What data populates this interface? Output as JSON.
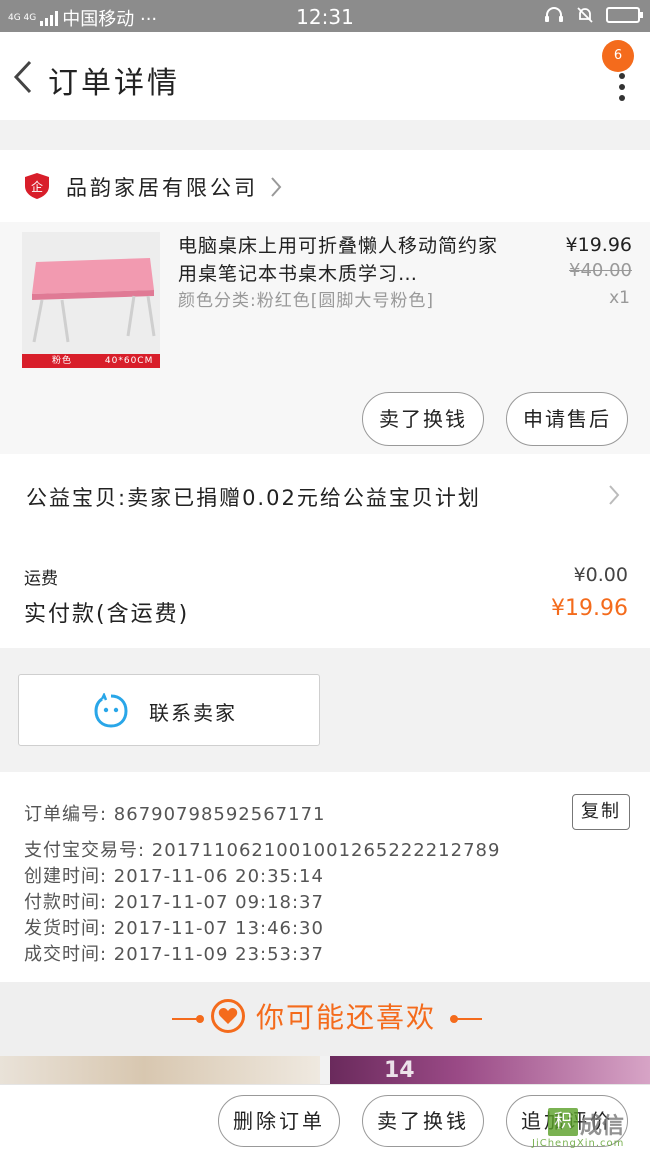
{
  "status_bar": {
    "network": "4G 4G",
    "carrier": "中国移动 ···",
    "time": "12:31",
    "battery_fraction": 0.0
  },
  "nav": {
    "title": "订单详情",
    "badge_count": "6"
  },
  "shop": {
    "logo_text": "企",
    "name": "品韵家居有限公司"
  },
  "product": {
    "title": "电脑桌床上用可折叠懒人移动简约家用桌笔记本书桌木质学习…",
    "attributes": "颜色分类:粉红色[圆脚大号粉色]",
    "price": "¥19.96",
    "original_price": "¥40.00",
    "quantity": "x1",
    "image_caption_color": "粉色",
    "image_caption_size": "40*60CM",
    "sell_back_label": "卖了换钱",
    "after_sales_label": "申请售后"
  },
  "charity": {
    "text": "公益宝贝:卖家已捐赠0.02元给公益宝贝计划"
  },
  "totals": {
    "shipping_label": "运费",
    "shipping_value": "¥0.00",
    "paid_label": "实付款(含运费)",
    "paid_value": "¥19.96"
  },
  "contact": {
    "label": "联系卖家"
  },
  "order_info": {
    "order_no": "订单编号: 86790798592567171",
    "alipay_no": "支付宝交易号: 2017110621001001265222212789",
    "created": "创建时间: 2017-11-06 20:35:14",
    "paid": "付款时间: 2017-11-07 09:18:37",
    "shipped": "发货时间: 2017-11-07 13:46:30",
    "completed": "成交时间: 2017-11-09 23:53:37",
    "copy_label": "复制"
  },
  "recommend": {
    "title": "你可能还喜欢",
    "image_text": "14"
  },
  "bottom_bar": {
    "delete_label": "删除订单",
    "sell_back_label": "卖了换钱",
    "review_label": "追加评价"
  },
  "watermark": {
    "box_text": "积",
    "text": "成信",
    "sub": "JiChengXin.com"
  },
  "colors": {
    "accent": "#f46b1c",
    "shop_logo": "#d81e2a",
    "contact_icon": "#29a6e8"
  }
}
